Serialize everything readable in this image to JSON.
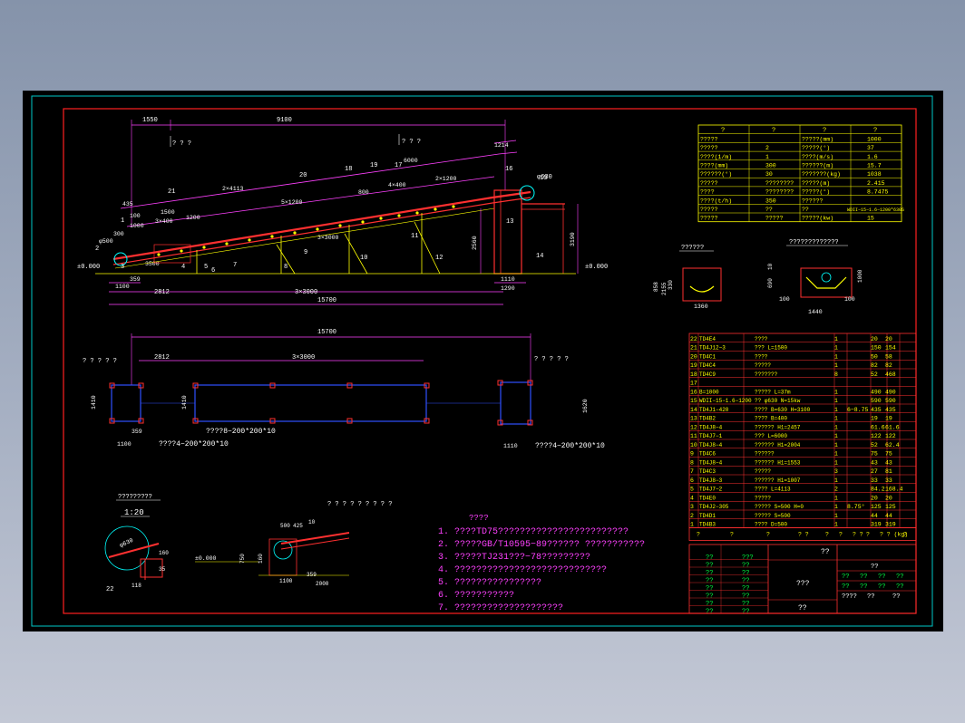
{
  "colors": {
    "background": "#000000",
    "frame_red": "#ff2020",
    "frame_cyan": "#00c8c8",
    "dim_magenta": "#ff40ff",
    "text_white": "#ffffff",
    "yellow": "#ffff00",
    "green": "#00ff40",
    "blue": "#3050ff",
    "belt_red": "#ff3030",
    "cyan": "#00ffff"
  },
  "elevation": {
    "dims_top": [
      "1550",
      "9100"
    ],
    "dim_1214": "1214",
    "dim_6000": "6000",
    "dim_2x1200": "2×1200",
    "dim_4x400": "4×400",
    "dim_800": "800",
    "dim_5x1200": "5×1200",
    "dim_2x4113": "2×4113",
    "dim_3x3000_slope": "3×3000",
    "dim_1500": "1500",
    "dim_3x400": "3×400",
    "dim_1200": "1200",
    "dim_435": "435",
    "dim_100": "100",
    "dim_1000": "1000",
    "dim_300": "300",
    "dim_3500": "3500",
    "dim_2560": "2560",
    "dim_3190": "3190",
    "phi500": "φ500",
    "phi630": "φ630",
    "level_left": "±0.000",
    "level_right": "±0.000",
    "marks_qq": [
      "? ? ?",
      "? ? ?"
    ],
    "base_dims": [
      "359",
      "1100",
      "2812",
      "3×3000",
      "15700",
      "1110",
      "1290"
    ],
    "callouts": [
      "1",
      "2",
      "3",
      "4",
      "5",
      "6",
      "7",
      "8",
      "9",
      "10",
      "11",
      "12",
      "13",
      "14",
      "15",
      "16",
      "17",
      "18",
      "19",
      "20",
      "21"
    ]
  },
  "plan": {
    "dim_total": "15700",
    "dim_2812": "2812",
    "dim_3x3000": "3×3000",
    "dim_1410a": "1410",
    "dim_1410b": "1410",
    "dim_1620": "1620",
    "dim_1100": "1100",
    "dim_359": "359",
    "dim_1110": "1110",
    "label_left": "? ? ? ? ?",
    "label_right": "? ? ? ? ?",
    "note_mid": "????8−200*200*10",
    "note_left": "????4−200*200*10",
    "note_right": "????4−200*200*10"
  },
  "sections": {
    "title_a": "??????",
    "title_b": "?????????????",
    "dims_a": [
      "858",
      "2155",
      "330",
      "1360"
    ],
    "dims_b": [
      "10",
      "690",
      "1000",
      "100",
      "100",
      "1440"
    ]
  },
  "detail": {
    "title": "?????????",
    "scale": "1:20",
    "phi": "φ630",
    "dims": [
      "160",
      "35",
      "118",
      "22"
    ]
  },
  "detail2": {
    "title": "? ? ? ? ? ? ? ? ?",
    "level": "±0.000",
    "dims": [
      "500",
      "425",
      "10",
      "750",
      "160",
      "1100",
      "359",
      "2000"
    ]
  },
  "notes": {
    "title": "????",
    "lines": [
      "1.  ????TD75????????????????????????",
      "2.  ?????GB/T10595−89??????  ???????????",
      "3.  ?????TJ231???−78?????????",
      "4.  ????????????????????????????",
      "5.  ????????????????",
      "6.  ???????????",
      "7.  ????????????????????"
    ]
  },
  "spec_table": {
    "headers": [
      "?",
      "?",
      "?",
      "?"
    ],
    "rows": [
      [
        "?????",
        "",
        "?????(mm)",
        "1000"
      ],
      [
        "?????",
        "2",
        "?????(°)",
        "37"
      ],
      [
        "????(1/m)",
        "1",
        "????(m/s)",
        "1.6"
      ],
      [
        "????(mm)",
        "300",
        "??????(m)",
        "15.7"
      ],
      [
        "??????(°)",
        "30",
        "???????(kg)",
        "1038"
      ],
      [
        "?????",
        "????????",
        "?????(m)",
        "2.415"
      ],
      [
        "????",
        "????????",
        "?????(°)",
        "8.7475"
      ],
      [
        "????(t/h)",
        "350",
        "??????",
        ""
      ],
      [
        "?????",
        "??",
        "??",
        "WDII−15−1.6−1200*630S"
      ],
      [
        "?????",
        "?????",
        "?????(kw)",
        "15"
      ]
    ]
  },
  "bom": {
    "rows": [
      [
        "22",
        "TD4E4",
        "????",
        "1",
        "",
        "20",
        "20"
      ],
      [
        "21",
        "TD4J12−3",
        "??? L=1500",
        "1",
        "",
        "150",
        "154"
      ],
      [
        "20",
        "TD4C1",
        "????",
        "1",
        "",
        "50",
        "58"
      ],
      [
        "19",
        "TD4C4",
        "?????",
        "1",
        "",
        "82",
        "82"
      ],
      [
        "18",
        "TD4C9",
        "???????",
        "8",
        "",
        "52",
        "468"
      ],
      [
        "17",
        "",
        "",
        "",
        "",
        "",
        ""
      ],
      [
        "16",
        "B=1000",
        "????? L=37m",
        "1",
        "",
        "490",
        "490"
      ],
      [
        "15",
        "WDII−15−1.6−1200",
        "?? φ630 N=15kw",
        "1",
        "",
        "590",
        "590"
      ],
      [
        "14",
        "TD4J1−420",
        "???? B=630 H=3100",
        "1",
        "6−8.75",
        "435",
        "435"
      ],
      [
        "13",
        "TD4B2",
        "???? B=400",
        "1",
        "",
        "19",
        "19"
      ],
      [
        "12",
        "TD4J8−4",
        "?????? H1=2457",
        "1",
        "",
        "61.6",
        "61.6"
      ],
      [
        "11",
        "TD4J7−1",
        "??? L=6000",
        "1",
        "",
        "122",
        "122"
      ],
      [
        "10",
        "TD4J8−4",
        "?????? H1=2004",
        "1",
        "",
        "52",
        "62.4"
      ],
      [
        "9",
        "TD4C6",
        "??????",
        "1",
        "",
        "75",
        "75"
      ],
      [
        "8",
        "TD4J8−4",
        "?????? H1=1553",
        "1",
        "",
        "43",
        "43"
      ],
      [
        "7",
        "TD4C3",
        "?????",
        "3",
        "",
        "27",
        "81"
      ],
      [
        "6",
        "TD4J8−3",
        "?????? H1=1007",
        "1",
        "",
        "33",
        "33"
      ],
      [
        "5",
        "TD4J7−2",
        "???? L=4113",
        "2",
        "",
        "84.2",
        "168.4"
      ],
      [
        "4",
        "TD4E0",
        "?????",
        "1",
        "",
        "20",
        "20"
      ],
      [
        "3",
        "TD4J2−305",
        "????? S=500 H=0",
        "1",
        "8.75°",
        "125",
        "125"
      ],
      [
        "2",
        "TD4D1",
        "????? S=500",
        "1",
        "",
        "44",
        "44"
      ],
      [
        "1",
        "TD4B3",
        "???? D=500",
        "1",
        "",
        "319",
        "319"
      ]
    ],
    "header": [
      "?",
      "?",
      "?",
      "? ?",
      "?",
      "?",
      "? ?",
      "?",
      "? ? (kg)",
      "?"
    ]
  },
  "title_block": {
    "left_labels": [
      "??",
      "??",
      "??",
      "??",
      "??",
      "??",
      "??",
      "??"
    ],
    "mid_labels": [
      "???",
      "??",
      "??",
      "??",
      "??",
      "??",
      "??",
      "??"
    ],
    "center_top": "??",
    "center_mid": "???",
    "center_bottom": "??",
    "right_top": "??",
    "right_row": [
      "??",
      "??",
      "??",
      "??"
    ],
    "right_row2": [
      "??",
      "??",
      "??",
      "??"
    ],
    "right_row3": [
      "????",
      "??",
      "??"
    ]
  }
}
